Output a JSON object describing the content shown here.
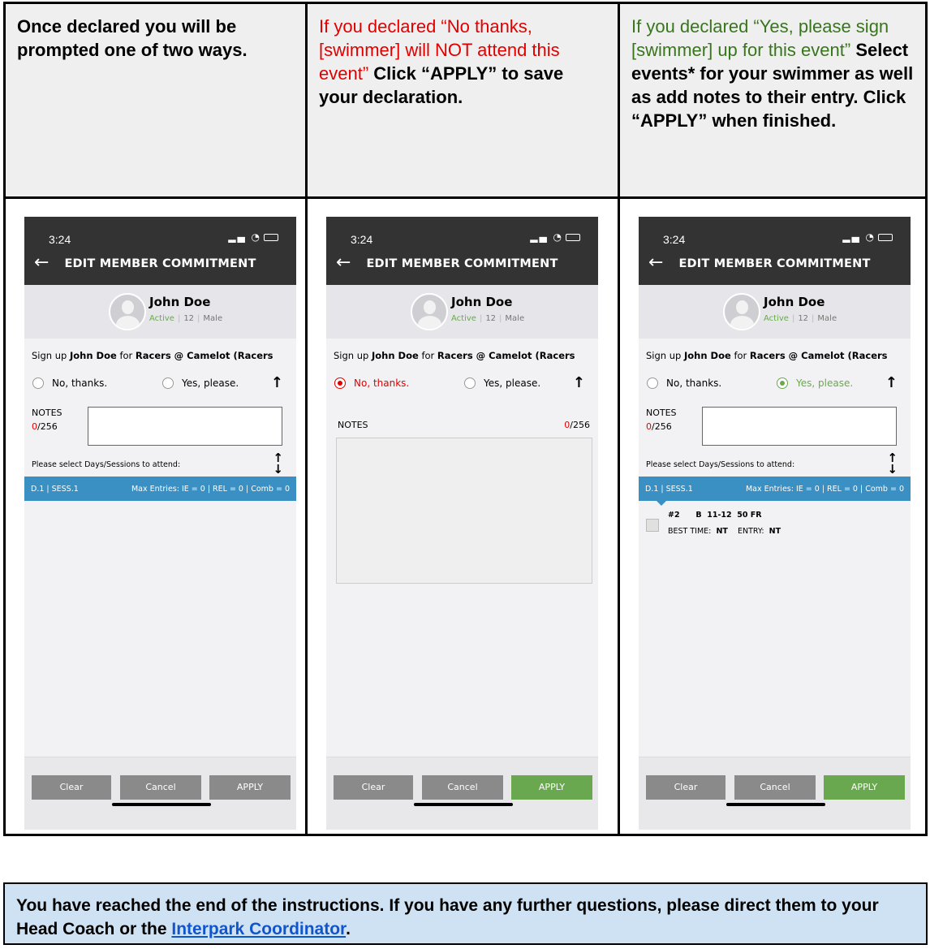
{
  "columns": [
    {
      "header_parts": [
        {
          "text": "Once declared you will be prompted one of two ways.",
          "style": "bold"
        }
      ]
    },
    {
      "header_parts": [
        {
          "text": "If you declared “No thanks, [swimmer] will NOT attend this event” ",
          "style": "red"
        },
        {
          "text": "Click “APPLY” to save your declaration.",
          "style": "bold"
        }
      ]
    },
    {
      "header_parts": [
        {
          "text": "If you declared “Yes, please sign [swimmer] up for this event” ",
          "style": "green"
        },
        {
          "text": "Select events* for your swimmer as well as add notes to their entry. Click “APPLY” when finished.",
          "style": "bold"
        }
      ]
    }
  ],
  "phone": {
    "time": "3:24",
    "title": "EDIT MEMBER COMMITMENT",
    "member_name": "John Doe",
    "status": "Active",
    "age": "12",
    "gender": "Male",
    "signup_prefix": "Sign up ",
    "signup_name": "John Doe",
    "signup_mid": " for ",
    "signup_event": "Racers @ Camelot (Racers",
    "no_label": "No, thanks.",
    "yes_label": "Yes, please.",
    "notes_label": "NOTES",
    "notes_count_used": "0",
    "notes_count_max": "/256",
    "days_label": "Please select Days/Sessions to attend:",
    "session_left": "D.1 | SESS.1",
    "session_right": "Max Entries: IE = 0 | REL = 0 | Comb = 0",
    "event_line1": "#2      B  11-12  50 FR",
    "event_line2_label1": "BEST TIME:",
    "event_line2_val1": "NT",
    "event_line2_label2": "ENTRY:",
    "event_line2_val2": "NT",
    "btn_clear": "Clear",
    "btn_cancel": "Cancel",
    "btn_apply": "APPLY"
  },
  "callout": {
    "text": "You have reached the end of the instructions. If you have any further questions, please direct them to your Head Coach or the ",
    "link": "Interpark Coordinator",
    "end": "."
  },
  "colors": {
    "red": "#e00000",
    "green": "#38761d",
    "app_green": "#6aa84f",
    "session_blue": "#3a8fc3",
    "callout_bg": "#cfe2f3",
    "header_bg": "#efefef"
  }
}
